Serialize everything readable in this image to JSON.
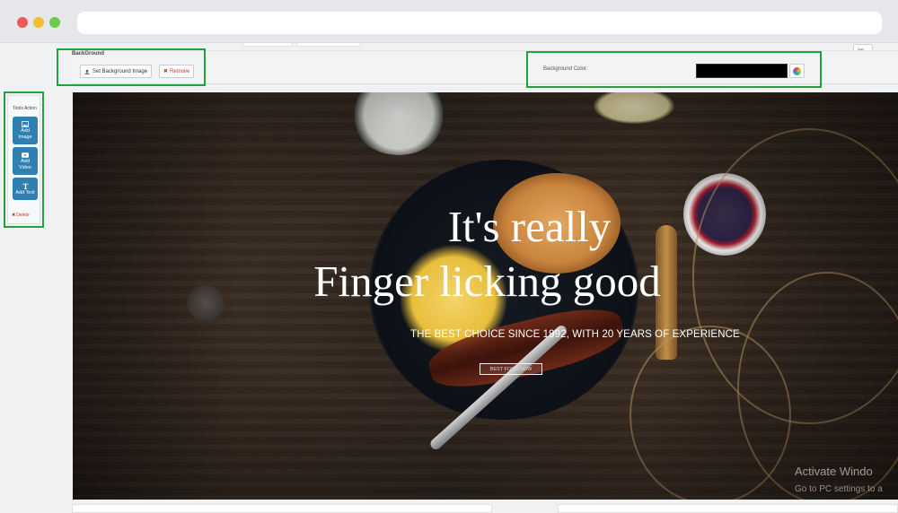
{
  "settings": {
    "section_title": "BackGround",
    "set_image_label": "Set Background Image",
    "remove_label": "Remove",
    "color_label": "Background Color:",
    "color_value": "#000000"
  },
  "language": {
    "selected": "en"
  },
  "tools": {
    "title": "Tools Action",
    "add_image": [
      "Add",
      "Image"
    ],
    "add_video": [
      "Add",
      "Video"
    ],
    "add_text": "Add Text",
    "delete": "Delete"
  },
  "hero": {
    "line1": "It's really",
    "line2": "Finger licking good",
    "subtitle": "THE BEST CHOICE SINCE 1992, WITH 20 YEARS OF EXPERIENCE",
    "cta": "BEST FOOD NOW"
  },
  "watermark": {
    "line1": "Activate Windo",
    "line2": "Go to PC settings to a"
  },
  "colors": {
    "highlight": "#22a33a",
    "tool_button": "#2f7fb1",
    "remove": "#c0392b"
  },
  "icons": {
    "set_image": "upload-icon",
    "remove": "close-icon",
    "color_picker": "color-wheel-icon",
    "add_image": "image-icon",
    "add_video": "video-icon",
    "add_text": "text-icon",
    "delete": "close-icon"
  }
}
